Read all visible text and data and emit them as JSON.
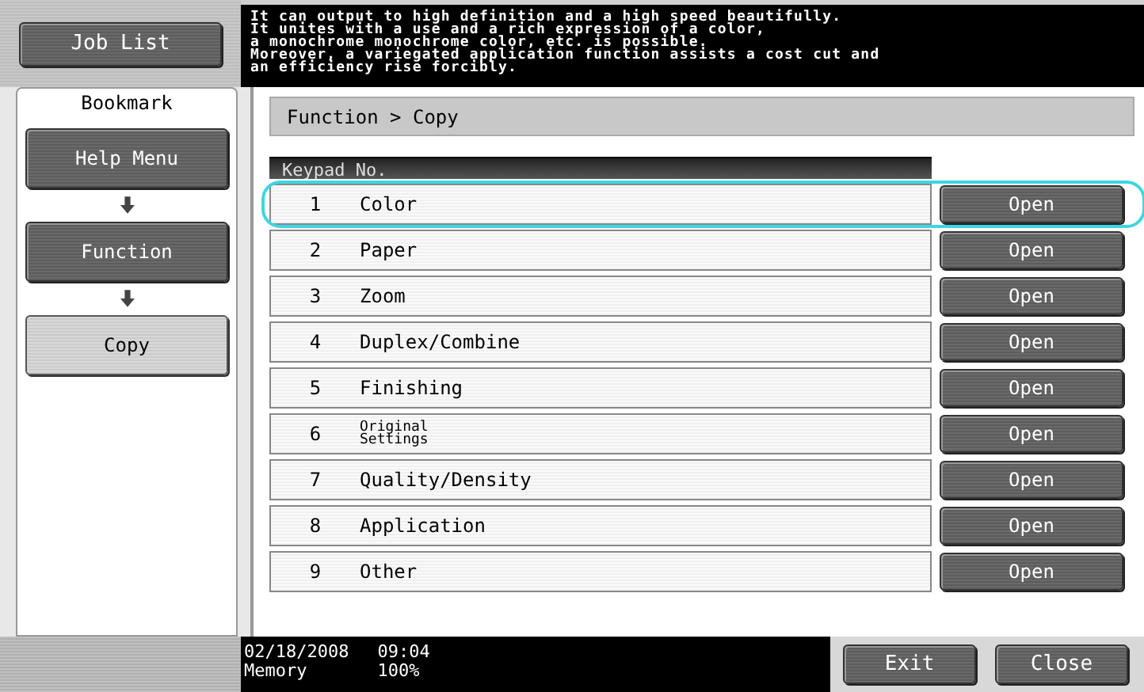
{
  "job_list_button": "Job List",
  "message": "It can output to high definition and a high speed beautifully.\nIt unites with a use and a rich expression of a color,\na monochrome monochrome color, etc. is possible.\nMoreover, a variegated application function assists a cost cut and\nan efficiency rise forcibly.",
  "bookmark": {
    "title": "Bookmark",
    "items": [
      {
        "label": "Help Menu",
        "selected": false
      },
      {
        "label": "Function",
        "selected": false
      },
      {
        "label": "Copy",
        "selected": true
      }
    ]
  },
  "breadcrumb": "Function > Copy",
  "list": {
    "header": "Keypad No.",
    "rows": [
      {
        "number": "1",
        "label": "Color",
        "button": "Open",
        "selected": true
      },
      {
        "number": "2",
        "label": "Paper",
        "button": "Open",
        "selected": false
      },
      {
        "number": "3",
        "label": "Zoom",
        "button": "Open",
        "selected": false
      },
      {
        "number": "4",
        "label": "Duplex/Combine",
        "button": "Open",
        "selected": false
      },
      {
        "number": "5",
        "label": "Finishing",
        "button": "Open",
        "selected": false
      },
      {
        "number": "6",
        "label": "Original\nSettings",
        "button": "Open",
        "selected": false
      },
      {
        "number": "7",
        "label": "Quality/Density",
        "button": "Open",
        "selected": false
      },
      {
        "number": "8",
        "label": "Application",
        "button": "Open",
        "selected": false
      },
      {
        "number": "9",
        "label": "Other",
        "button": "Open",
        "selected": false
      }
    ]
  },
  "status_bar": {
    "date": "02/18/2008",
    "time": "09:04",
    "memory_label": "Memory",
    "memory_value": "100%"
  },
  "buttons": [
    "Exit",
    "Close"
  ]
}
